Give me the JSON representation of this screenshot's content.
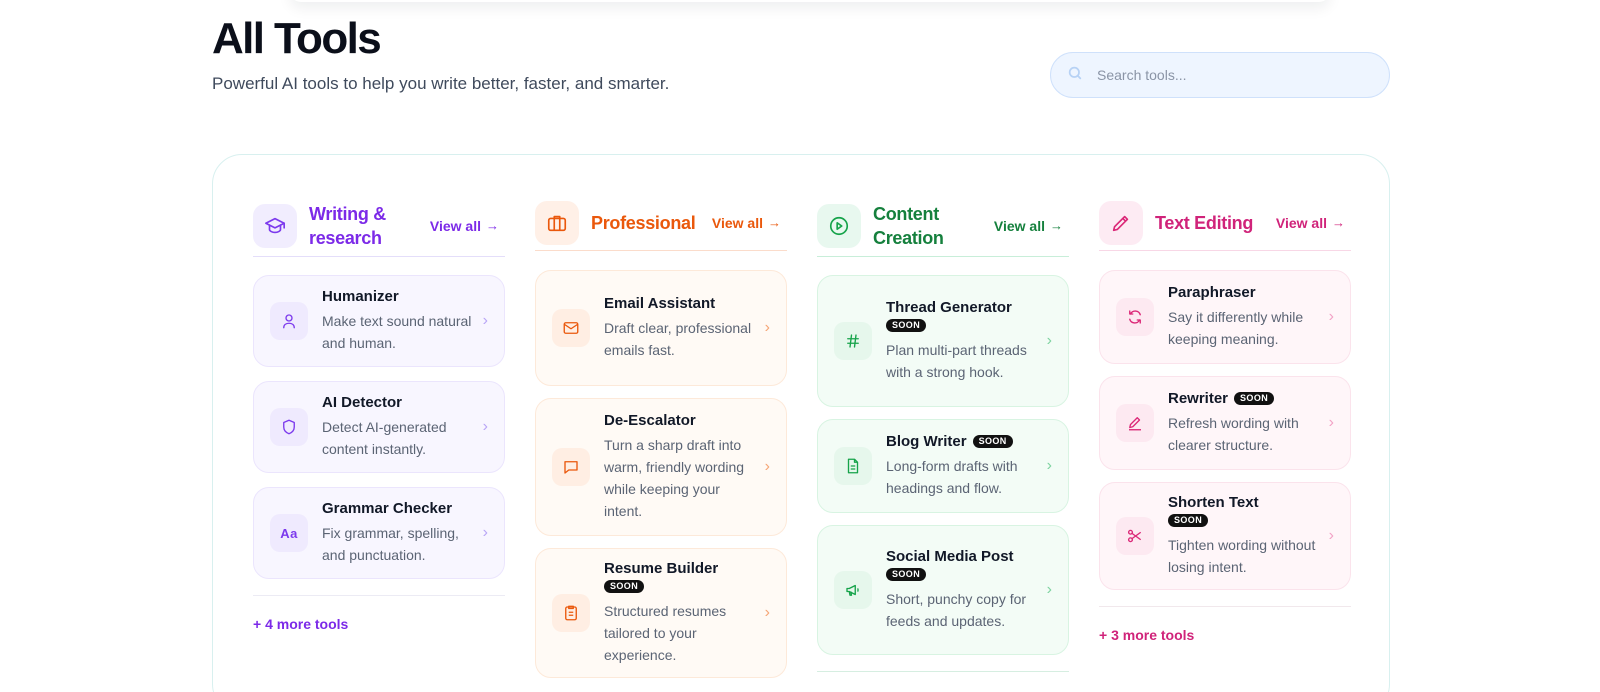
{
  "page": {
    "title": "All Tools",
    "subtitle": "Powerful AI tools to help you write better, faster, and smarter."
  },
  "search": {
    "placeholder": "Search tools..."
  },
  "badge_label": "SOON",
  "categories": [
    {
      "title": "Writing & research",
      "view_all": "View all",
      "icon": "graduation-cap-icon",
      "color": "#7c3aed",
      "tools": [
        {
          "name": "Humanizer",
          "desc": "Make text sound natural and human.",
          "icon": "user-icon"
        },
        {
          "name": "AI Detector",
          "desc": "Detect AI-generated content instantly.",
          "icon": "shield-icon"
        },
        {
          "name": "Grammar Checker",
          "desc": "Fix grammar, spelling, and punctuation.",
          "icon": "text-aa-icon",
          "icon_text": "Aa"
        }
      ],
      "more": "+ 4 more tools"
    },
    {
      "title": "Professional",
      "view_all": "View all",
      "icon": "briefcase-icon",
      "color": "#ea580c",
      "tools": [
        {
          "name": "Email Assistant",
          "desc": "Draft clear, professional emails fast.",
          "icon": "mail-icon"
        },
        {
          "name": "De-Escalator",
          "desc": "Turn a sharp draft into warm, friendly wording while keeping your intent.",
          "icon": "message-square-icon"
        },
        {
          "name": "Resume Builder",
          "desc": "Structured resumes tailored to your experience.",
          "icon": "clipboard-list-icon",
          "soon": true
        }
      ]
    },
    {
      "title": "Content Creation",
      "view_all": "View all",
      "icon": "play-circle-icon",
      "color": "#16a34a",
      "tools": [
        {
          "name": "Thread Generator",
          "desc": "Plan multi-part threads with a strong hook.",
          "icon": "hash-icon",
          "soon": true
        },
        {
          "name": "Blog Writer",
          "desc": "Long-form drafts with headings and flow.",
          "icon": "file-text-icon",
          "soon": true
        },
        {
          "name": "Social Media Post",
          "desc": "Short, punchy copy for feeds and updates.",
          "icon": "megaphone-icon",
          "soon": true
        }
      ]
    },
    {
      "title": "Text Editing",
      "view_all": "View all",
      "icon": "pencil-icon",
      "color": "#db2777",
      "tools": [
        {
          "name": "Paraphraser",
          "desc": "Say it differently while keeping meaning.",
          "icon": "refresh-icon"
        },
        {
          "name": "Rewriter",
          "desc": "Refresh wording with clearer structure.",
          "icon": "pen-line-icon",
          "soon": true
        },
        {
          "name": "Shorten Text",
          "desc": "Tighten wording without losing intent.",
          "icon": "scissors-icon",
          "soon": true
        }
      ],
      "more": "+ 3 more tools"
    }
  ]
}
